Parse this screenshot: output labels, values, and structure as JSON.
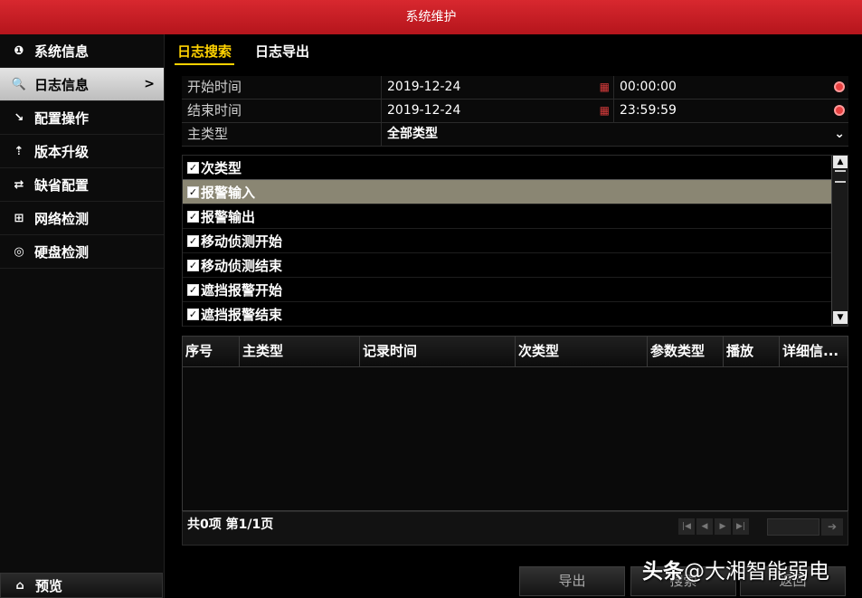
{
  "window": {
    "title": "系统维护"
  },
  "sidebar": {
    "items": [
      {
        "label": "系统信息",
        "icon": "❶"
      },
      {
        "label": "日志信息",
        "icon": "🔍"
      },
      {
        "label": "配置操作",
        "icon": "↘"
      },
      {
        "label": "版本升级",
        "icon": "⇡"
      },
      {
        "label": "缺省配置",
        "icon": "⇄"
      },
      {
        "label": "网络检测",
        "icon": "⊞"
      },
      {
        "label": "硬盘检测",
        "icon": "◎"
      }
    ],
    "active_chevron": ">",
    "preview_label": "预览"
  },
  "tabs": [
    {
      "label": "日志搜索"
    },
    {
      "label": "日志导出"
    }
  ],
  "form": {
    "start": {
      "label": "开始时间",
      "date": "2019-12-24",
      "time": "00:00:00"
    },
    "end": {
      "label": "结束时间",
      "date": "2019-12-24",
      "time": "23:59:59"
    },
    "main_type": {
      "label": "主类型",
      "value": "全部类型"
    }
  },
  "subtypes": {
    "header": "次类型",
    "items": [
      "报警输入",
      "报警输出",
      "移动侦测开始",
      "移动侦测结束",
      "遮挡报警开始",
      "遮挡报警结束"
    ]
  },
  "table": {
    "columns": [
      "序号",
      "主类型",
      "记录时间",
      "次类型",
      "参数类型",
      "播放",
      "详细信..."
    ]
  },
  "pager": {
    "summary": "共0项 第1/1页"
  },
  "buttons": {
    "export": "导出",
    "search": "搜索",
    "back": "返回"
  },
  "watermark": {
    "brand": "头条",
    "handle": "@大湘智能弱电"
  },
  "colors": {
    "title_bar": "#c21d24",
    "active_tab": "#ffd200",
    "highlight_row": "#8a8673"
  }
}
